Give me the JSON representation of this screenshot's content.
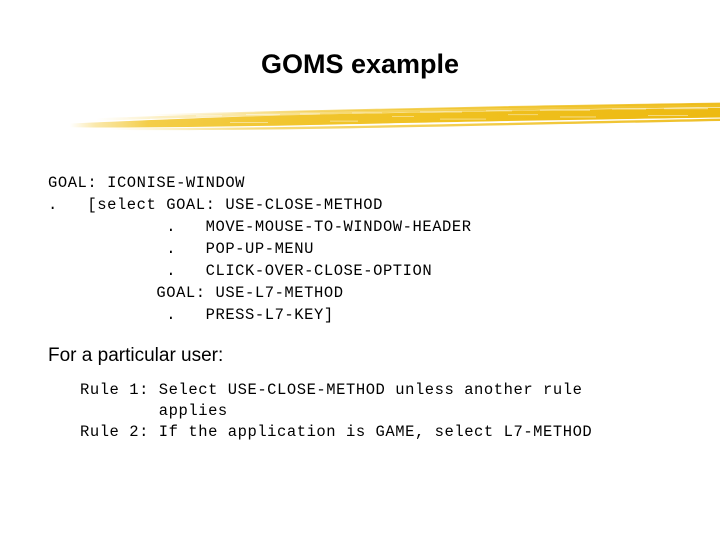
{
  "slide": {
    "title": "GOMS example",
    "background_color": "#FFFFFF",
    "text_color": "#000000",
    "accent_color": "#EFC01E"
  },
  "divider": {
    "name": "yellow-brush-stroke",
    "color": "#EFC01E",
    "color_light": "#F7D867",
    "color_dark": "#E8B410"
  },
  "goms_code": {
    "lines": [
      "GOAL: ICONISE-WINDOW",
      ".   [select GOAL: USE-CLOSE-METHOD",
      "            .   MOVE-MOUSE-TO-WINDOW-HEADER",
      "            .   POP-UP-MENU",
      "            .   CLICK-OVER-CLOSE-OPTION",
      "           GOAL: USE-L7-METHOD",
      "            .   PRESS-L7-KEY]"
    ]
  },
  "user_heading": "For a particular user:",
  "rules": {
    "lines": [
      "Rule 1: Select USE-CLOSE-METHOD unless another rule",
      "        applies",
      "Rule 2: If the application is GAME, select L7-METHOD"
    ]
  }
}
